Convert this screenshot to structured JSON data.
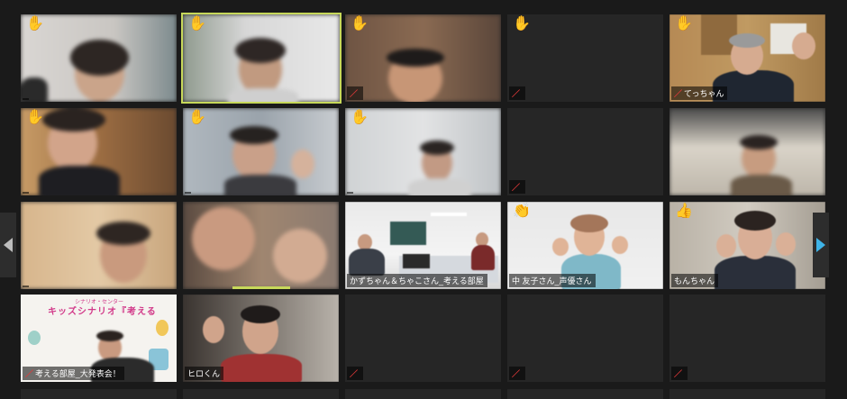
{
  "participants": [
    {
      "name": "",
      "hand_raised": true
    },
    {
      "name": "",
      "hand_raised": true,
      "active_speaker": true
    },
    {
      "name": "",
      "hand_raised": true
    },
    {
      "name": "",
      "hand_raised": true
    },
    {
      "name": "てっちゃん",
      "hand_raised": true,
      "muted": true
    },
    {
      "name": "",
      "hand_raised": true
    },
    {
      "name": "",
      "hand_raised": true
    },
    {
      "name": "",
      "hand_raised": true
    },
    {
      "name": "",
      "hand_raised": false
    },
    {
      "name": "",
      "hand_raised": false
    },
    {
      "name": "",
      "hand_raised": false
    },
    {
      "name": "",
      "hand_raised": false
    },
    {
      "name": "かずちゃん＆ちゃこさん_考える部屋",
      "hand_raised": false
    },
    {
      "name": "中 友子さん_声優さん",
      "hand_raised": false,
      "reaction": "clap"
    },
    {
      "name": "もんちゃん",
      "hand_raised": false,
      "reaction": "thumbs-up"
    },
    {
      "name": "考える部屋_大発表会！",
      "hand_raised": false,
      "muted": true
    },
    {
      "name": "ヒロくん",
      "hand_raised": false
    },
    {
      "name": "",
      "hand_raised": false,
      "muted": true
    },
    {
      "name": "",
      "hand_raised": false,
      "muted": true
    },
    {
      "name": "",
      "hand_raised": false,
      "muted": true
    }
  ],
  "poster": {
    "title": "キッズシナリオ『考える",
    "subtitle": "シナリオ・センター"
  },
  "icons": {
    "raised_hand": "✋",
    "clap": "👏",
    "thumbs_up": "👍",
    "mic_muted": "mic-muted-icon",
    "prev_page": "chevron-left-icon",
    "next_page": "chevron-right-icon"
  },
  "colors": {
    "background": "#1a1a1a",
    "tile": "#262626",
    "active_speaker_border": "#c7d85a",
    "next_arrow": "#3fb4e8",
    "muted_mic": "#e23a3a"
  }
}
